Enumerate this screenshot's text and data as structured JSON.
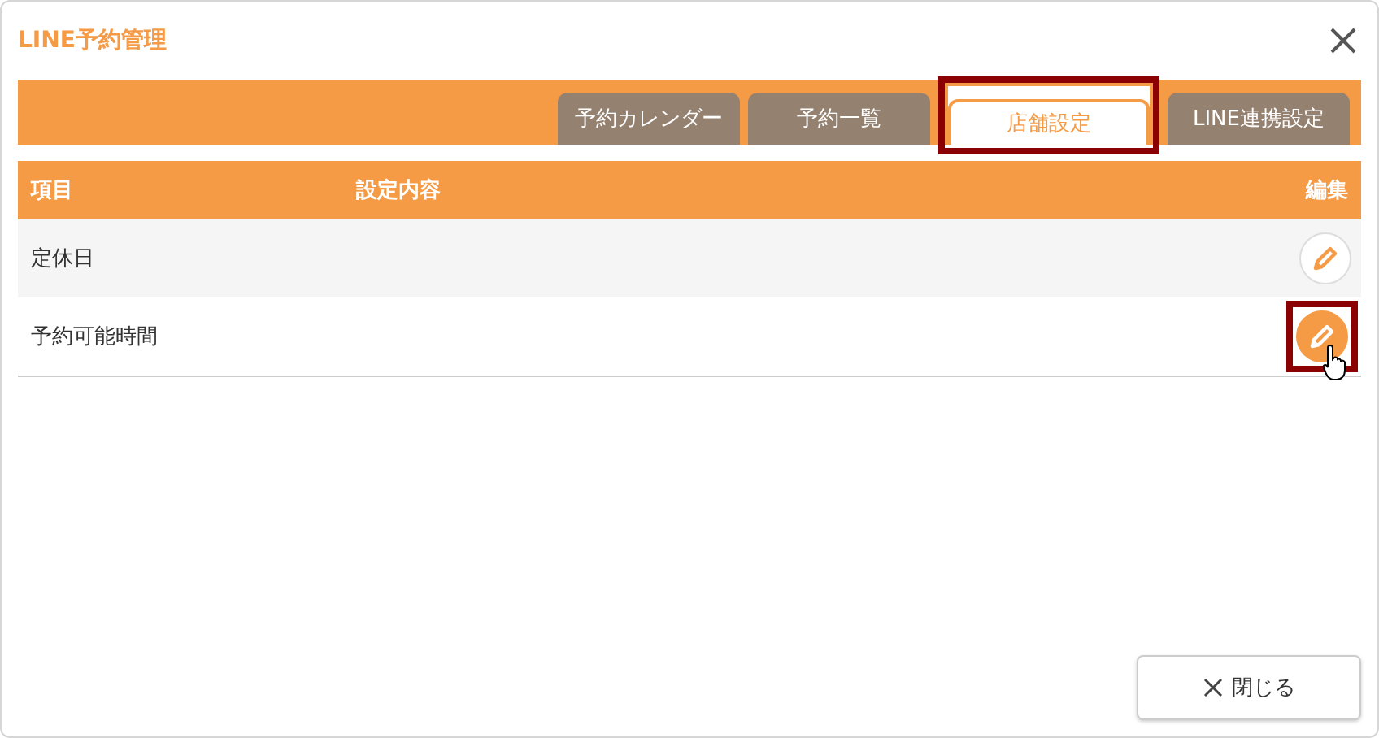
{
  "dialog": {
    "title": "LINE予約管理"
  },
  "tabs": [
    {
      "label": "予約カレンダー",
      "selected": false,
      "highlighted": false
    },
    {
      "label": "予約一覧",
      "selected": false,
      "highlighted": false
    },
    {
      "label": "店舗設定",
      "selected": true,
      "highlighted": true
    },
    {
      "label": "LINE連携設定",
      "selected": false,
      "highlighted": false
    }
  ],
  "table": {
    "columns": [
      "項目",
      "設定内容",
      "編集"
    ],
    "rows": [
      {
        "item": "定休日",
        "hovered": false,
        "highlighted": false
      },
      {
        "item": "予約可能時間",
        "hovered": true,
        "highlighted": true
      }
    ]
  },
  "buttons": [
    {
      "label": "閉じる"
    }
  ]
}
